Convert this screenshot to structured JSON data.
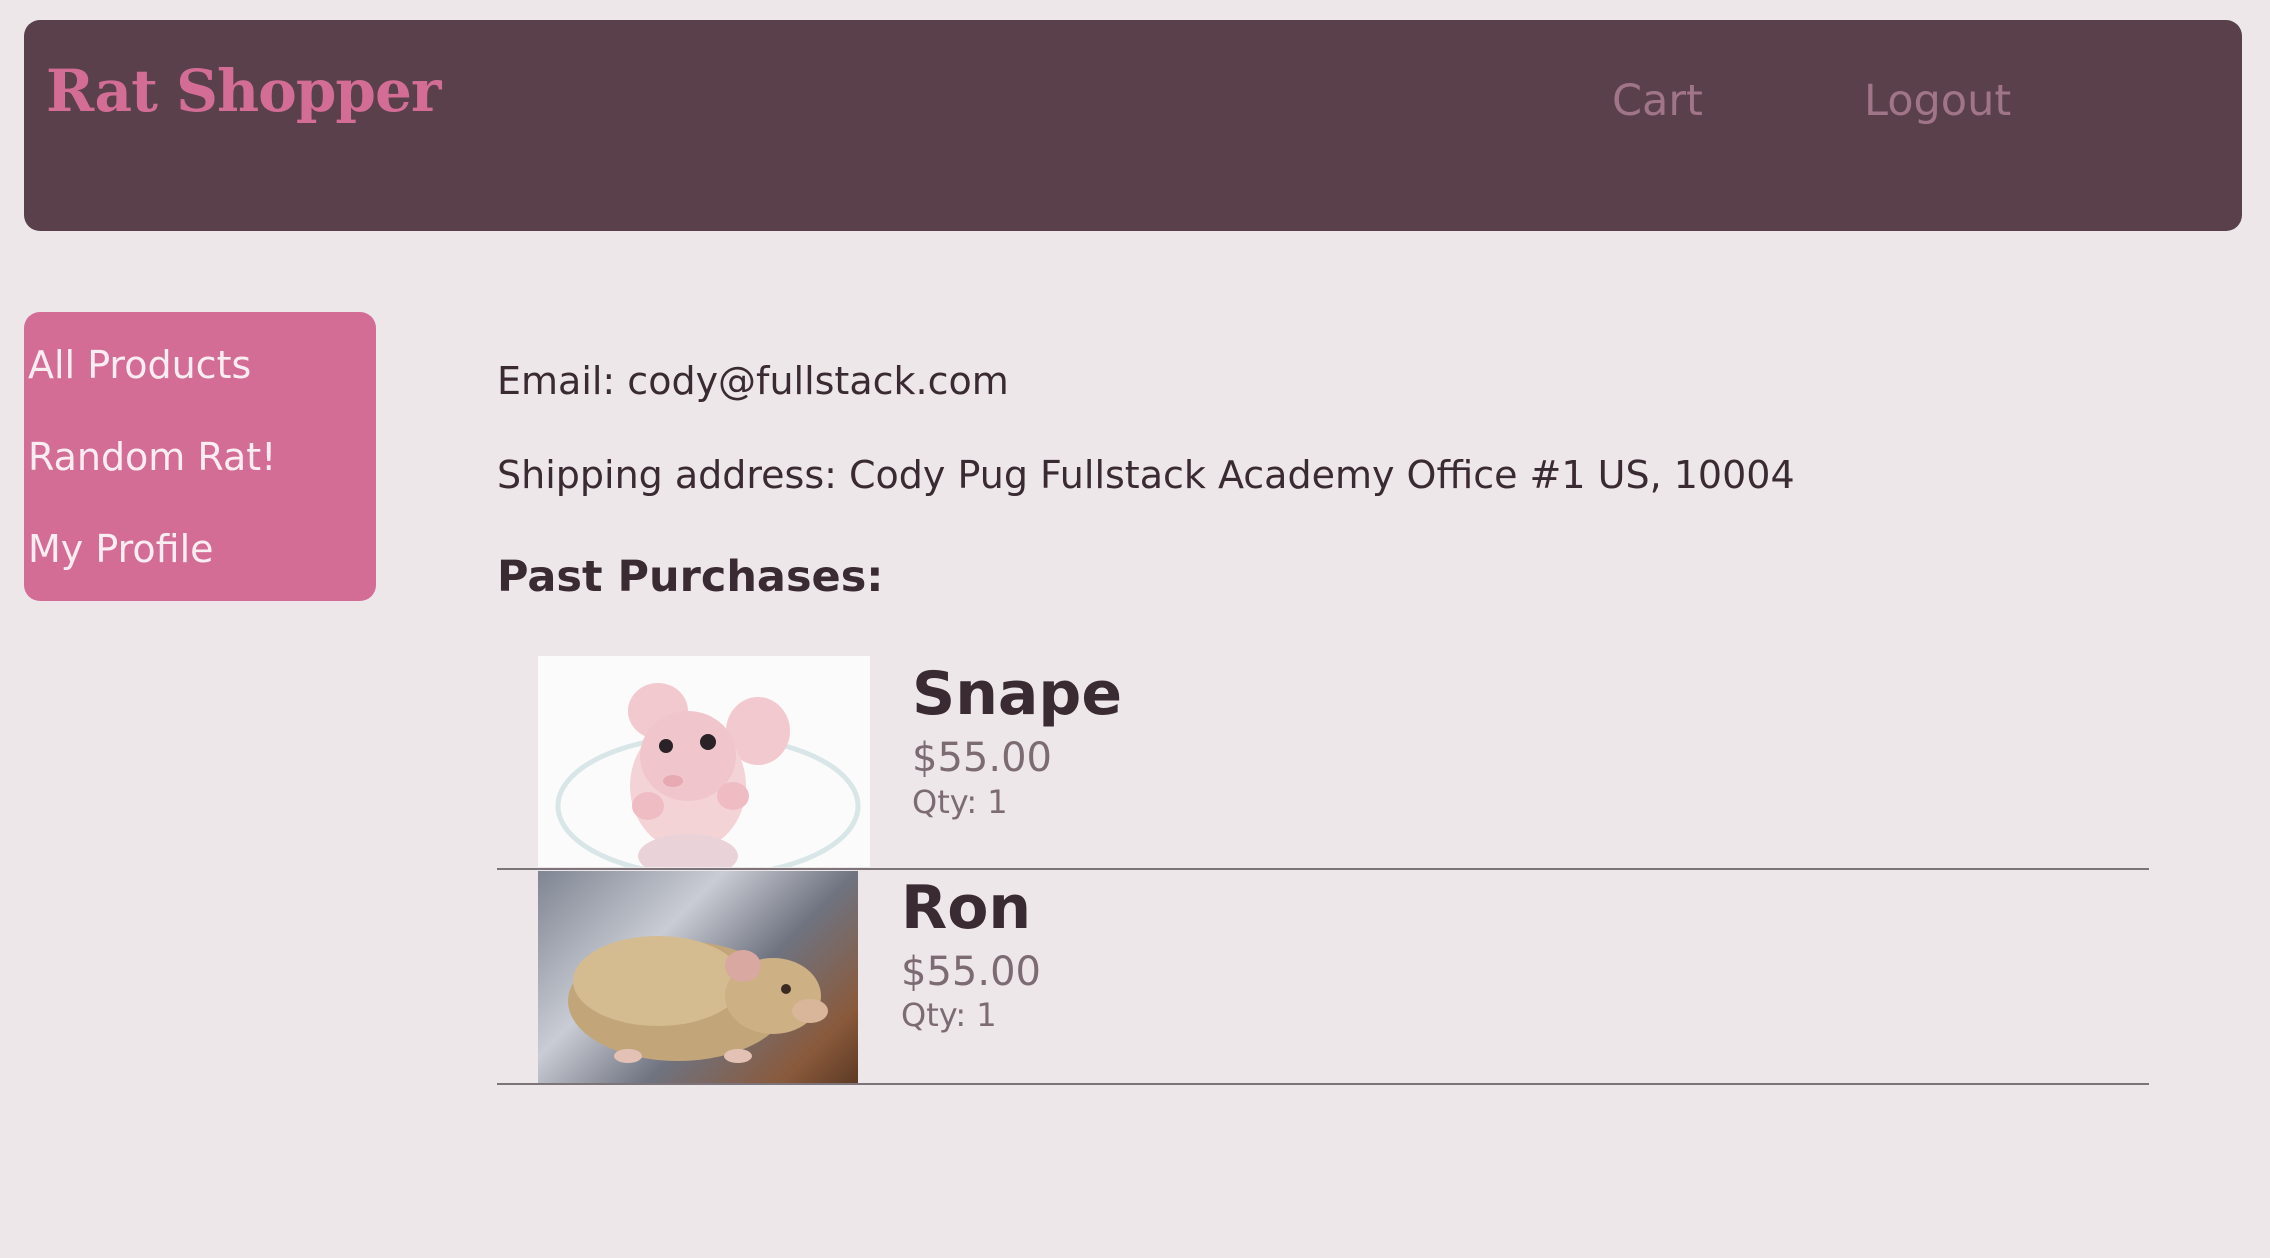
{
  "header": {
    "logo": "Rat Shopper",
    "nav": {
      "cart": "Cart",
      "logout": "Logout"
    }
  },
  "sidebar": {
    "items": [
      {
        "label": "All Products"
      },
      {
        "label": "Random Rat!"
      },
      {
        "label": "My Profile"
      }
    ]
  },
  "profile": {
    "email_line": "Email: cody@fullstack.com",
    "address_line": "Shipping address: Cody Pug Fullstack Academy Office #1 US, 10004",
    "past_purchases_heading": "Past Purchases:"
  },
  "purchases": [
    {
      "name": "Snape",
      "price": "$55.00",
      "qty": "Qty: 1",
      "image": "hairless-pink-rat-photo"
    },
    {
      "name": "Ron",
      "price": "$55.00",
      "qty": "Qty: 1",
      "image": "tan-rat-photo"
    }
  ],
  "colors": {
    "background": "#ede7ea",
    "header_bg": "#5a404b",
    "accent_pink": "#d46d96",
    "nav_link": "#a07588",
    "text_dark": "#3a2a31",
    "text_muted": "#7d6b73"
  }
}
